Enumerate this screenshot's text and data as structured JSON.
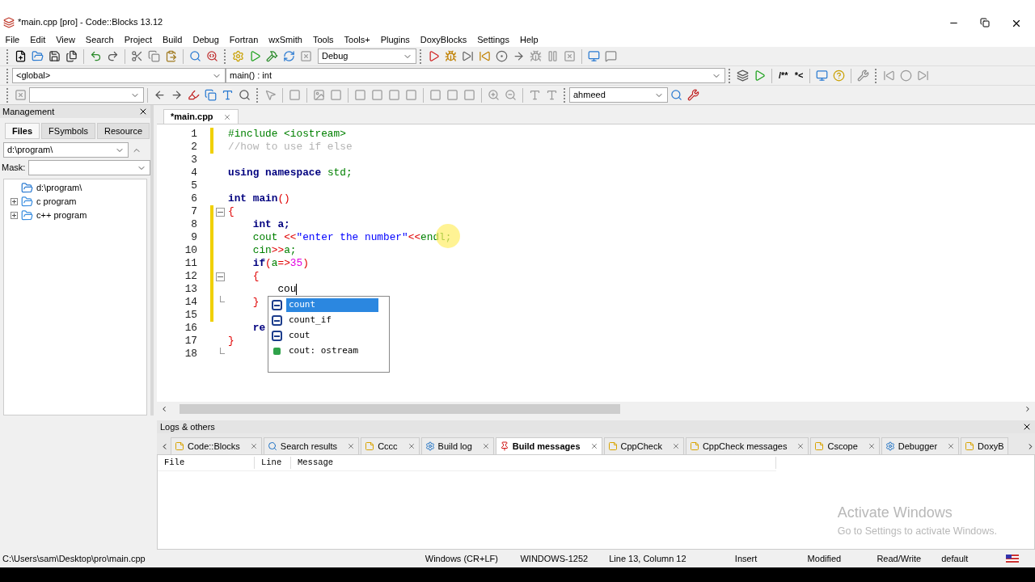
{
  "window": {
    "title": "*main.cpp [pro] - Code::Blocks 13.12"
  },
  "menu": [
    "File",
    "Edit",
    "View",
    "Search",
    "Project",
    "Build",
    "Debug",
    "Fortran",
    "wxSmith",
    "Tools",
    "Tools+",
    "Plugins",
    "DoxyBlocks",
    "Settings",
    "Help"
  ],
  "toolbar": {
    "build_target": "Debug",
    "scope": "<global>",
    "function": "main() : int",
    "doc_comment": "/**",
    "doc_inline": "*<",
    "search_text": "ahmeed"
  },
  "management": {
    "title": "Management",
    "tabs": [
      {
        "label": "Files",
        "selected": true
      },
      {
        "label": "FSymbols",
        "selected": false
      },
      {
        "label": "Resource",
        "selected": false
      }
    ],
    "path": "d:\\program\\",
    "mask_label": "Mask:",
    "tree": [
      {
        "label": "d:\\program\\",
        "expanded": true,
        "children": [
          {
            "label": "c program",
            "expanded": false
          },
          {
            "label": "c++ program",
            "expanded": false
          }
        ]
      }
    ]
  },
  "editor": {
    "tabs": [
      {
        "label": "*main.cpp",
        "selected": true
      }
    ],
    "lines": [
      {
        "number": "1",
        "changed": true,
        "fold_start": false,
        "fold_end": false,
        "tokens": [
          {
            "kind": "preproc",
            "text": "#include <iostream>"
          }
        ]
      },
      {
        "number": "2",
        "changed": true,
        "fold_start": false,
        "fold_end": false,
        "tokens": [
          {
            "kind": "comment",
            "text": "//how to use if else"
          }
        ]
      },
      {
        "number": "3",
        "changed": false,
        "fold_start": false,
        "fold_end": false
      },
      {
        "number": "4",
        "changed": false,
        "fold_start": false,
        "fold_end": false,
        "tokens": [
          {
            "kind": "keyword",
            "text": "using namespace "
          },
          {
            "kind": "ident",
            "text": "std;"
          }
        ]
      },
      {
        "number": "5",
        "changed": false,
        "fold_start": false,
        "fold_end": false
      },
      {
        "number": "6",
        "changed": false,
        "fold_start": false,
        "fold_end": false,
        "tokens": [
          {
            "kind": "keyword",
            "text": "int main"
          },
          {
            "kind": "operator",
            "text": "()"
          }
        ]
      },
      {
        "number": "7",
        "changed": true,
        "fold_start": true,
        "fold_end": false,
        "tokens": [
          {
            "kind": "operator",
            "text": "{"
          }
        ]
      },
      {
        "number": "8",
        "changed": true,
        "fold_start": false,
        "fold_end": false,
        "tokens": [
          {
            "kind": "keyword",
            "text": "    int a;"
          }
        ]
      },
      {
        "number": "9",
        "changed": true,
        "fold_start": false,
        "fold_end": false,
        "tokens": [
          {
            "kind": "ident",
            "text": "    cout "
          },
          {
            "kind": "operator",
            "text": "<<"
          },
          {
            "kind": "string",
            "text": "\"enter the number\""
          },
          {
            "kind": "operator",
            "text": "<<"
          },
          {
            "kind": "ident",
            "text": "endl;"
          }
        ]
      },
      {
        "number": "10",
        "changed": true,
        "fold_start": false,
        "fold_end": false,
        "tokens": [
          {
            "kind": "ident",
            "text": "    cin"
          },
          {
            "kind": "operator",
            "text": ">>"
          },
          {
            "kind": "ident",
            "text": "a;"
          }
        ]
      },
      {
        "number": "11",
        "changed": true,
        "fold_start": false,
        "fold_end": false,
        "tokens": [
          {
            "kind": "keyword",
            "text": "    if"
          },
          {
            "kind": "operator",
            "text": "("
          },
          {
            "kind": "ident",
            "text": "a"
          },
          {
            "kind": "operator",
            "text": "=>"
          },
          {
            "kind": "number",
            "text": "35"
          },
          {
            "kind": "operator",
            "text": ")"
          }
        ]
      },
      {
        "number": "12",
        "changed": true,
        "fold_start": true,
        "fold_end": false,
        "tokens": [
          {
            "kind": "operator",
            "text": "    {"
          }
        ]
      },
      {
        "number": "13",
        "changed": true,
        "fold_start": false,
        "fold_end": false,
        "caret": true,
        "tokens": [
          {
            "kind": "plain",
            "text": "        cou"
          }
        ]
      },
      {
        "number": "14",
        "changed": true,
        "fold_start": false,
        "fold_end": true,
        "tokens": [
          {
            "kind": "operator",
            "text": "    }"
          }
        ]
      },
      {
        "number": "15",
        "changed": true,
        "fold_start": false,
        "fold_end": false
      },
      {
        "number": "16",
        "changed": false,
        "fold_start": false,
        "fold_end": false,
        "tokens": [
          {
            "kind": "keyword",
            "text": "    re"
          }
        ]
      },
      {
        "number": "17",
        "changed": false,
        "fold_start": false,
        "fold_end": false,
        "tokens": [
          {
            "kind": "operator",
            "text": "}"
          }
        ]
      },
      {
        "number": "18",
        "changed": false,
        "fold_start": false,
        "fold_end": true
      }
    ],
    "completions": [
      {
        "label": "count",
        "kind": "function",
        "selected": true
      },
      {
        "label": "count_if",
        "kind": "function",
        "selected": false
      },
      {
        "label": "cout",
        "kind": "function",
        "selected": false
      },
      {
        "label": "cout: ostream",
        "kind": "variable",
        "selected": false
      }
    ]
  },
  "logs": {
    "title": "Logs & others",
    "tabs": [
      {
        "label": "Code::Blocks",
        "kind": "note",
        "selected": false
      },
      {
        "label": "Search results",
        "kind": "search",
        "selected": false
      },
      {
        "label": "Cccc",
        "kind": "note",
        "selected": false
      },
      {
        "label": "Build log",
        "kind": "gear",
        "selected": false
      },
      {
        "label": "Build messages",
        "kind": "pin",
        "selected": true
      },
      {
        "label": "CppCheck",
        "kind": "note",
        "selected": false
      },
      {
        "label": "CppCheck messages",
        "kind": "note",
        "selected": false
      },
      {
        "label": "Cscope",
        "kind": "note",
        "selected": false
      },
      {
        "label": "Debugger",
        "kind": "gear",
        "selected": false
      },
      {
        "label": "DoxyB",
        "kind": "note",
        "selected": false
      }
    ],
    "columns": [
      "File",
      "Line",
      "Message"
    ]
  },
  "os_notice": {
    "title": "Activate Windows",
    "subtitle": "Go to Settings to activate Windows."
  },
  "status_bar": [
    "C:\\Users\\sam\\Desktop\\pro\\main.cpp",
    "Windows (CR+LF)",
    "WINDOWS-1252",
    "Line 13, Column 12",
    "Insert",
    "Modified",
    "Read/Write",
    "default"
  ]
}
